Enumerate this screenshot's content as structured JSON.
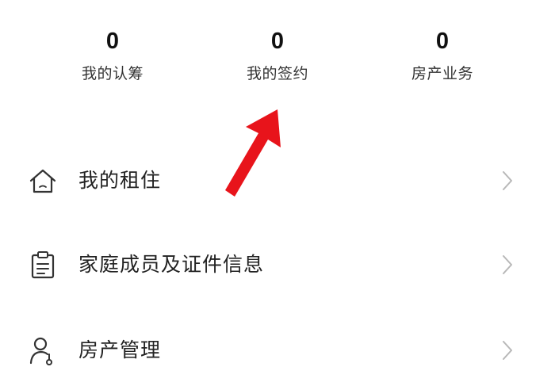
{
  "stats": [
    {
      "value": "0",
      "label": "我的认筹"
    },
    {
      "value": "0",
      "label": "我的签约"
    },
    {
      "value": "0",
      "label": "房产业务"
    }
  ],
  "menu": [
    {
      "label": "我的租住",
      "icon": "house-icon"
    },
    {
      "label": "家庭成员及证件信息",
      "icon": "clipboard-icon"
    },
    {
      "label": "房产管理",
      "icon": "person-key-icon"
    }
  ],
  "annotation": {
    "icon": "red-arrow-icon",
    "color": "#e8141b"
  }
}
